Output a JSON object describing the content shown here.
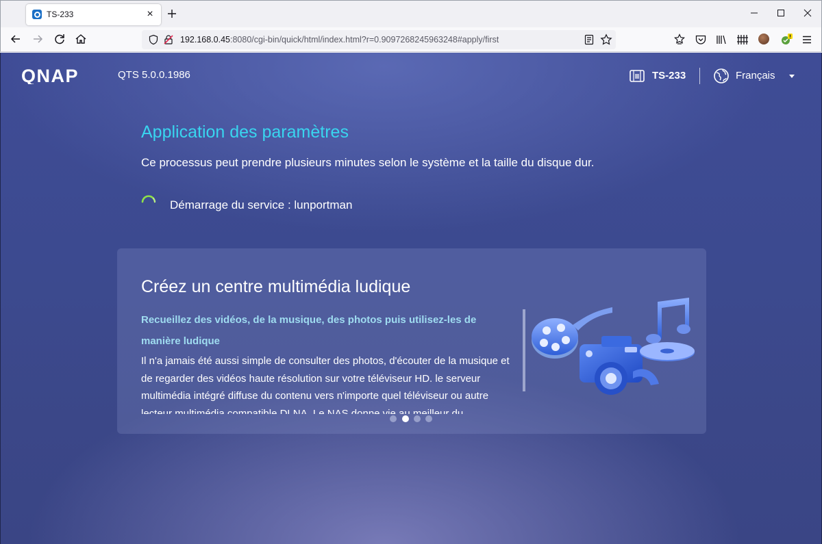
{
  "browser": {
    "tab_title": "TS-233",
    "url_host": "192.168.0.45",
    "url_rest": ":8080/cgi-bin/quick/html/index.html?r=0.9097268245963248#apply/first"
  },
  "header": {
    "brand": "QNAP",
    "version": "QTS 5.0.0.1986",
    "model": "TS-233",
    "language": "Français"
  },
  "apply": {
    "title": "Application des paramètres",
    "description": "Ce processus peut prendre plusieurs minutes selon le système et la taille du disque dur.",
    "status": "Démarrage du service : lunportman"
  },
  "feature_card": {
    "title": "Créez un centre multimédia ludique",
    "subtitle": "Recueillez des vidéos, de la musique, des photos puis utilisez-les de manière ludique",
    "body": "Il n'a jamais été aussi simple de consulter des photos, d'écouter de la musique et de regarder des vidéos haute résolution sur votre téléviseur HD. le serveur multimédia intégré diffuse du contenu vers n'importe quel téléviseur ou autre lecteur multimédia compatible DLNA. Le NAS donne vie au meilleur du",
    "illustration": "multimedia-icon",
    "carousel": {
      "total": 4,
      "active": 2
    }
  },
  "colors": {
    "accent_title": "#39d5ef",
    "subtitle": "#9fdcf0",
    "spinner": "#8ee04a"
  }
}
